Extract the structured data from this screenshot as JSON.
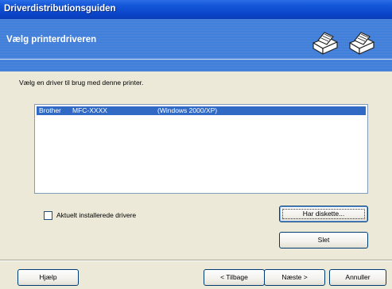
{
  "window": {
    "title": "Driverdistributionsguiden"
  },
  "header": {
    "title": "Vælg printerdriveren",
    "icons": [
      "printer-icon",
      "printer-icon"
    ]
  },
  "main": {
    "instruction": "Vælg en driver til brug med denne printer.",
    "driver_list": [
      {
        "manufacturer": "Brother",
        "model": "MFC-XXXX",
        "os": "(Windows 2000/XP)",
        "selected": true
      }
    ],
    "checkbox": {
      "label": "Aktuelt installerede drivere",
      "checked": false
    },
    "have_disk_label": "Har diskette...",
    "delete_label": "Slet"
  },
  "footer": {
    "help_label": "Hjælp",
    "back_label": "< Tilbage",
    "next_label": "Næste >",
    "cancel_label": "Annuller"
  },
  "colors": {
    "titlebar": "#0a44c8",
    "header": "#3b7bd8",
    "selection": "#316ac5",
    "background": "#ece9d8"
  }
}
